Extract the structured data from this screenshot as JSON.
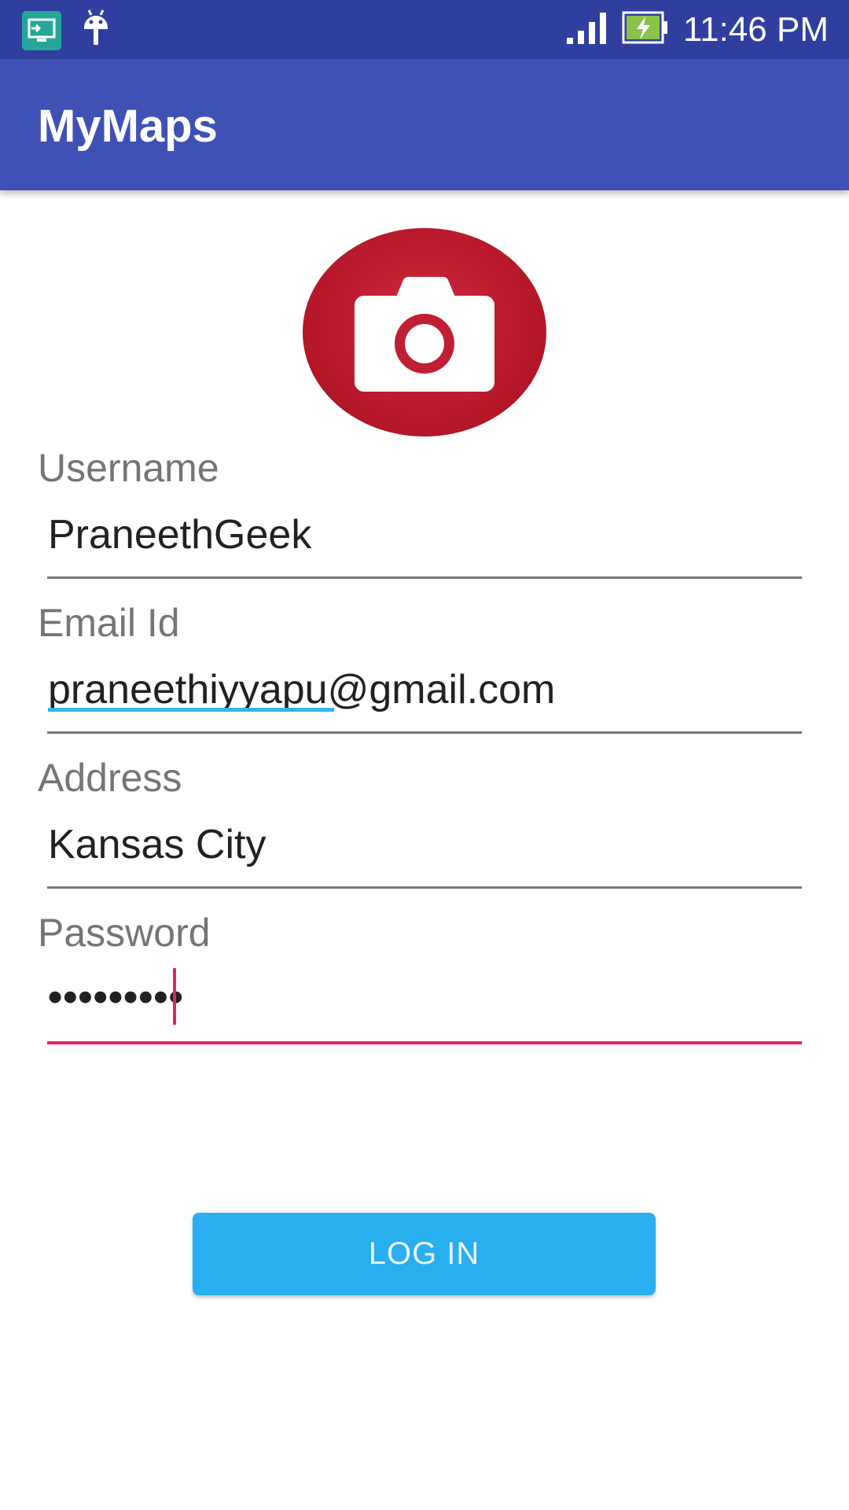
{
  "status_bar": {
    "time": "11:46 PM",
    "icons": [
      "screencast-icon",
      "android-icon",
      "signal-icon",
      "battery-charging-icon"
    ]
  },
  "app_bar": {
    "title": "MyMaps"
  },
  "profile": {
    "icon": "camera-icon",
    "color": "#c01f33"
  },
  "form": {
    "username": {
      "label": "Username",
      "value": "PraneethGeek"
    },
    "email": {
      "label": "Email Id",
      "value": "praneethiyyapu@gmail.com"
    },
    "address": {
      "label": "Address",
      "value": "Kansas City"
    },
    "password": {
      "label": "Password",
      "value": "•••••••••"
    }
  },
  "actions": {
    "login_label": "LOG IN"
  },
  "colors": {
    "primary_dark": "#303f9f",
    "primary": "#3f51b5",
    "accent": "#e91e63",
    "button": "#29aff0"
  }
}
